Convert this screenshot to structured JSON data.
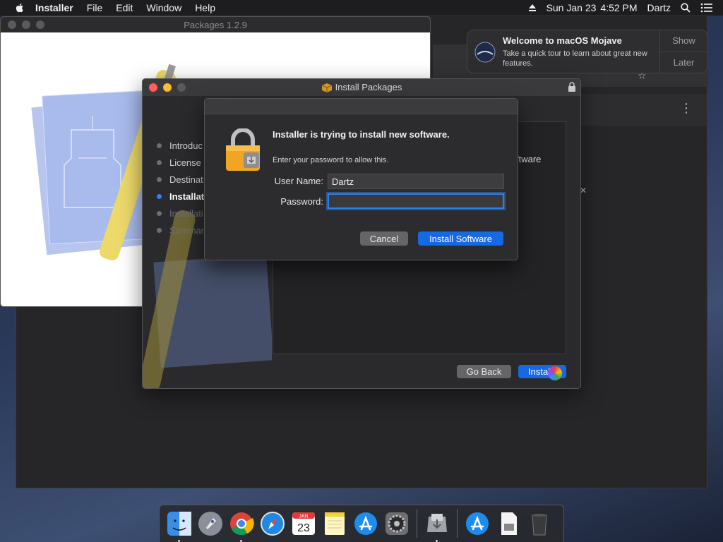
{
  "menubar": {
    "app_name": "Installer",
    "items": [
      "File",
      "Edit",
      "Window",
      "Help"
    ],
    "date": "Sun Jan 23",
    "time": "4:52 PM",
    "user": "Dartz"
  },
  "packages_window": {
    "title": "Packages 1.2.9"
  },
  "notification": {
    "title": "Welcome to macOS Mojave",
    "text": "Take a quick tour to learn about great new features.",
    "show_label": "Show",
    "later_label": "Later"
  },
  "installer_window": {
    "title": "Install Packages",
    "steps": [
      {
        "label": "Introduc",
        "state": "done"
      },
      {
        "label": "License",
        "state": "done"
      },
      {
        "label": "Destinat",
        "state": "done"
      },
      {
        "label": "Installat",
        "state": "active"
      },
      {
        "label": "Installati",
        "state": "future"
      },
      {
        "label": "Summar",
        "state": "future"
      }
    ],
    "content_snippet": "ftware",
    "go_back_label": "Go Back",
    "install_label": "Install"
  },
  "auth_dialog": {
    "heading": "Installer is trying to install new software.",
    "subtext": "Enter your password to allow this.",
    "username_label": "User Name:",
    "username_value": "Dartz",
    "password_label": "Password:",
    "password_value": "",
    "cancel_label": "Cancel",
    "confirm_label": "Install Software"
  },
  "dock": {
    "calendar_month": "JAN",
    "calendar_day": "23"
  },
  "colors": {
    "accent": "#1668e3",
    "focus_ring": "#2f7fe0",
    "close": "#fe5f57",
    "minimize": "#febc2e",
    "zoom": "#5a5a5c"
  }
}
